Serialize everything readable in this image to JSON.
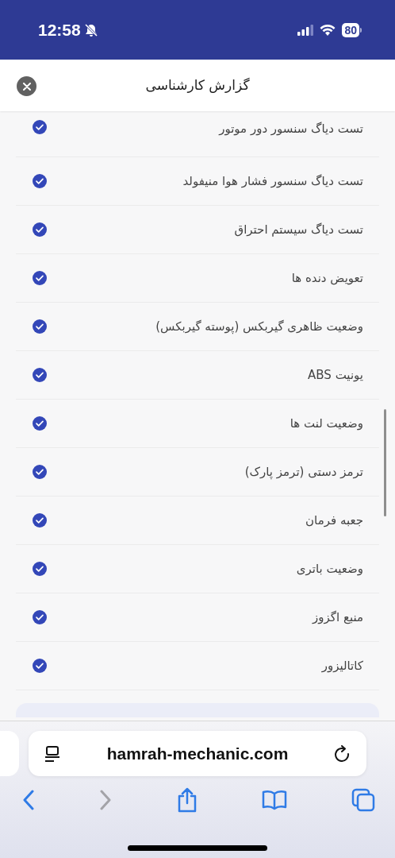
{
  "status_bar": {
    "time": "12:58",
    "silent": true,
    "battery": "80"
  },
  "sheet": {
    "title": "گزارش کارشناسی"
  },
  "items": [
    {
      "label": "تست دیاگ سنسور دور موتور",
      "checked": true
    },
    {
      "label": "تست دیاگ سنسور فشار هوا منیفولد",
      "checked": true
    },
    {
      "label": "تست دیاگ سیستم احتراق",
      "checked": true
    },
    {
      "label": "تعویض دنده ها",
      "checked": true
    },
    {
      "label": "وضعیت ظاهری گیربکس (پوسته گیربکس)",
      "checked": true
    },
    {
      "label": "یونیت ABS",
      "checked": true
    },
    {
      "label": "وضعیت لنت ها",
      "checked": true
    },
    {
      "label": "ترمز دستی (ترمز پارک)",
      "checked": true
    },
    {
      "label": "جعبه فرمان",
      "checked": true
    },
    {
      "label": "وضعیت باتری",
      "checked": true
    },
    {
      "label": "منبع اگزوز",
      "checked": true
    },
    {
      "label": "کاتالیزور",
      "checked": true
    }
  ],
  "browser": {
    "url": "hamrah-mechanic.com",
    "back_enabled": true,
    "forward_enabled": false
  }
}
